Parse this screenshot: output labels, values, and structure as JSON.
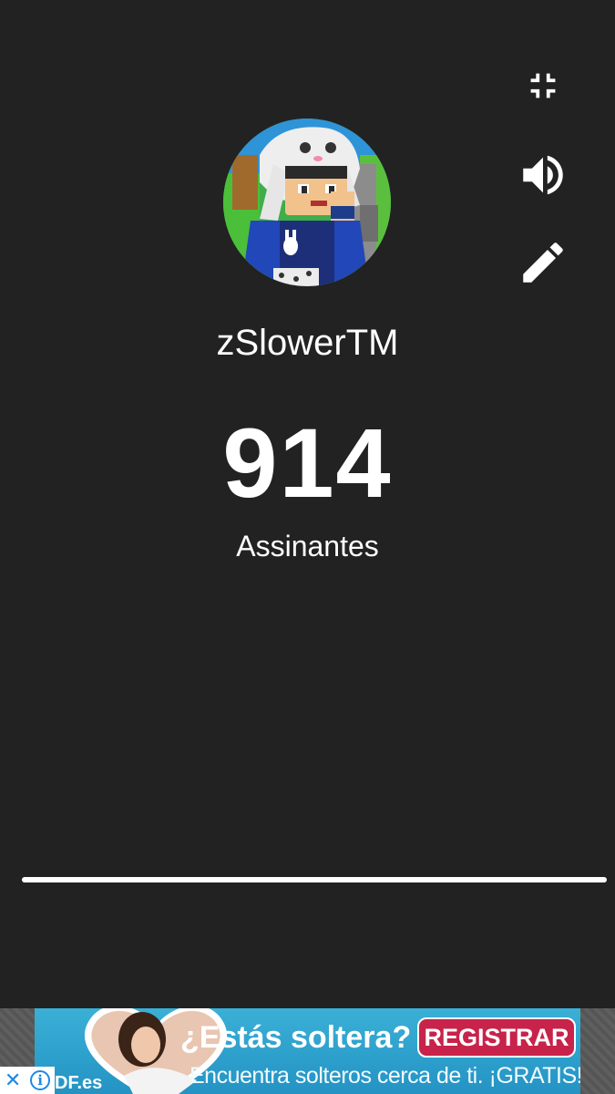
{
  "channel": {
    "name": "zSlowerTM",
    "subscriber_count": "914",
    "subscriber_label": "Assinantes",
    "avatar_icon": "channel-avatar"
  },
  "controls": [
    {
      "name": "collapse-icon",
      "icon": "fullscreen-exit"
    },
    {
      "name": "volume-icon",
      "icon": "volume-up"
    },
    {
      "name": "edit-icon",
      "icon": "pencil"
    }
  ],
  "progress": {
    "fraction": 1.0
  },
  "ad": {
    "headline": "¿Estás soltera?",
    "cta_label": "REGISTRAR",
    "subline": "Encuentra solteros cerca de ti. ¡GRATIS!",
    "brand": "DF.es",
    "close_glyph": "✕",
    "info_glyph": "i",
    "colors": {
      "background": "#2493c4",
      "cta": "#c8234a"
    }
  },
  "colors": {
    "background": "#222222",
    "text": "#ffffff"
  }
}
